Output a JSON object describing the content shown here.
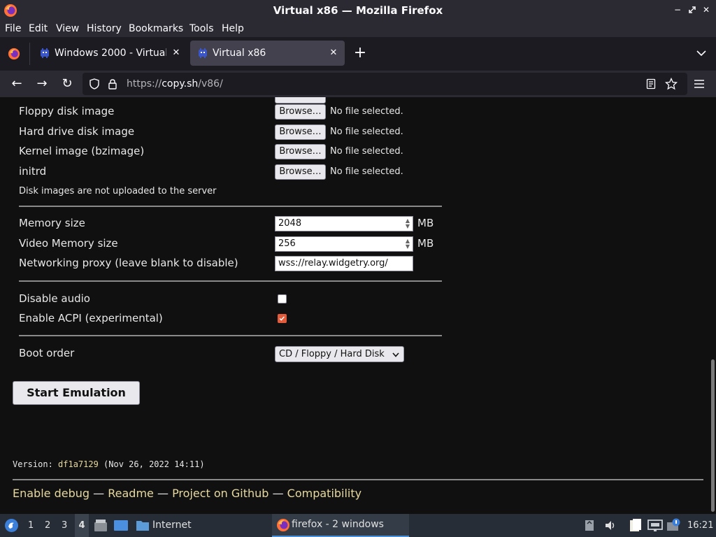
{
  "window": {
    "title": "Virtual x86 — Mozilla Firefox"
  },
  "menu": [
    "File",
    "Edit",
    "View",
    "History",
    "Bookmarks",
    "Tools",
    "Help"
  ],
  "tabs": [
    {
      "label": "Windows 2000 - Virtual x",
      "active": false
    },
    {
      "label": "Virtual x86",
      "active": true
    }
  ],
  "urlbar": {
    "scheme": "https://",
    "host": "copy.sh",
    "path": "/v86/"
  },
  "form": {
    "browse_label": "Browse…",
    "no_file": "No file selected.",
    "files": [
      {
        "label": "Floppy disk image"
      },
      {
        "label": "Hard drive disk image"
      },
      {
        "label": "Kernel image (bzimage)"
      },
      {
        "label": "initrd"
      }
    ],
    "disk_note": "Disk images are not uploaded to the server",
    "memory_label": "Memory size",
    "memory_value": "2048",
    "memory_unit": "MB",
    "vmem_label": "Video Memory size",
    "vmem_value": "256",
    "vmem_unit": "MB",
    "proxy_label": "Networking proxy (leave blank to disable)",
    "proxy_value": "wss://relay.widgetry.org/",
    "disable_audio_label": "Disable audio",
    "disable_audio_checked": false,
    "acpi_label": "Enable ACPI (experimental)",
    "acpi_checked": true,
    "boot_label": "Boot order",
    "boot_value": "CD / Floppy / Hard Disk",
    "start_button": "Start Emulation"
  },
  "footer": {
    "version_prefix": "Version: ",
    "version_hash": "df1a7129",
    "version_date": " (Nov 26, 2022 14:11)",
    "links": [
      "Enable debug",
      "Readme",
      "Project on Github",
      "Compatibility"
    ],
    "separator": "—"
  },
  "taskbar": {
    "workspaces": [
      "1",
      "2",
      "3",
      "4"
    ],
    "active_workspace": "4",
    "folder_label": "Internet",
    "task_label": "firefox - 2 windows",
    "clock": "16:21"
  },
  "colors": {
    "accent": "#e25b3b",
    "link": "#e6d8a0",
    "hash": "#e6d8a0"
  }
}
